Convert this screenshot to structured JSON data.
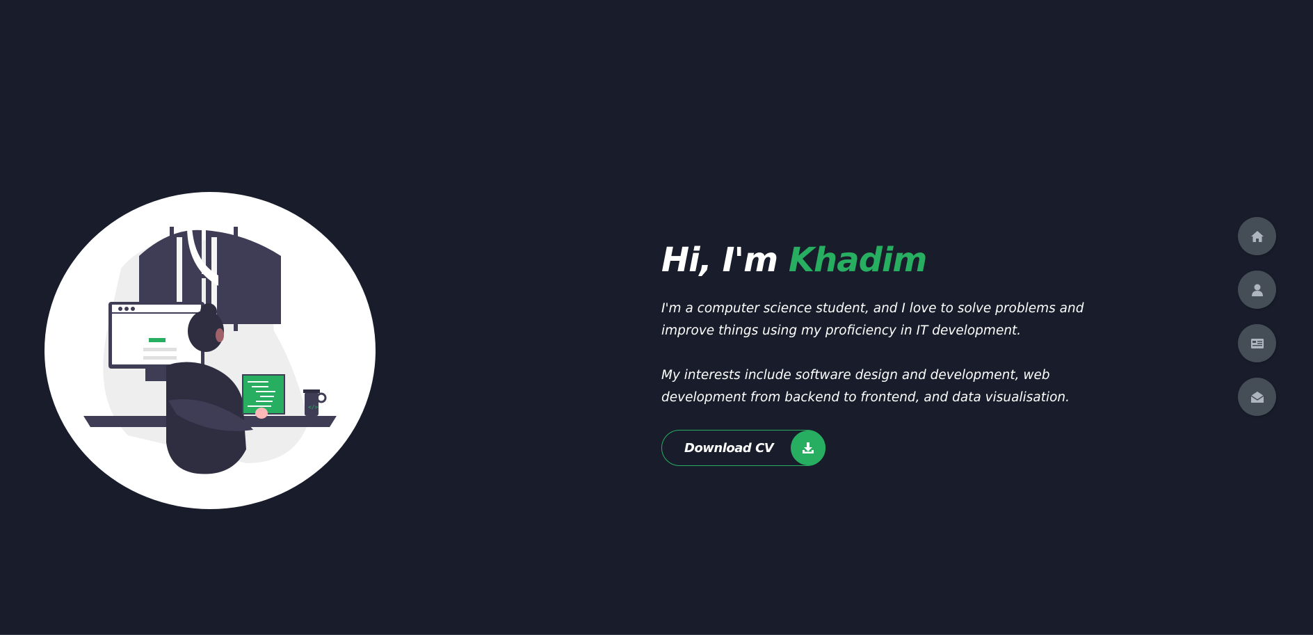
{
  "hero": {
    "title_prefix": "Hi, I'm ",
    "title_name": "Khadim",
    "paragraph_1": "I'm a computer science student, and I love to solve problems and improve things using my proficiency in IT development.",
    "paragraph_2": "My interests include software design and development, web development from backend to frontend, and data visualisation.",
    "cv_button_label": "Download CV",
    "cv_button_icon": "download-icon"
  },
  "nav": {
    "items": [
      {
        "icon": "home-icon"
      },
      {
        "icon": "user-icon"
      },
      {
        "icon": "portfolio-icon"
      },
      {
        "icon": "envelope-icon"
      }
    ]
  },
  "colors": {
    "background": "#191d2b",
    "accent": "#27ae60",
    "nav_button": "#454e56",
    "text": "#ffffff"
  }
}
